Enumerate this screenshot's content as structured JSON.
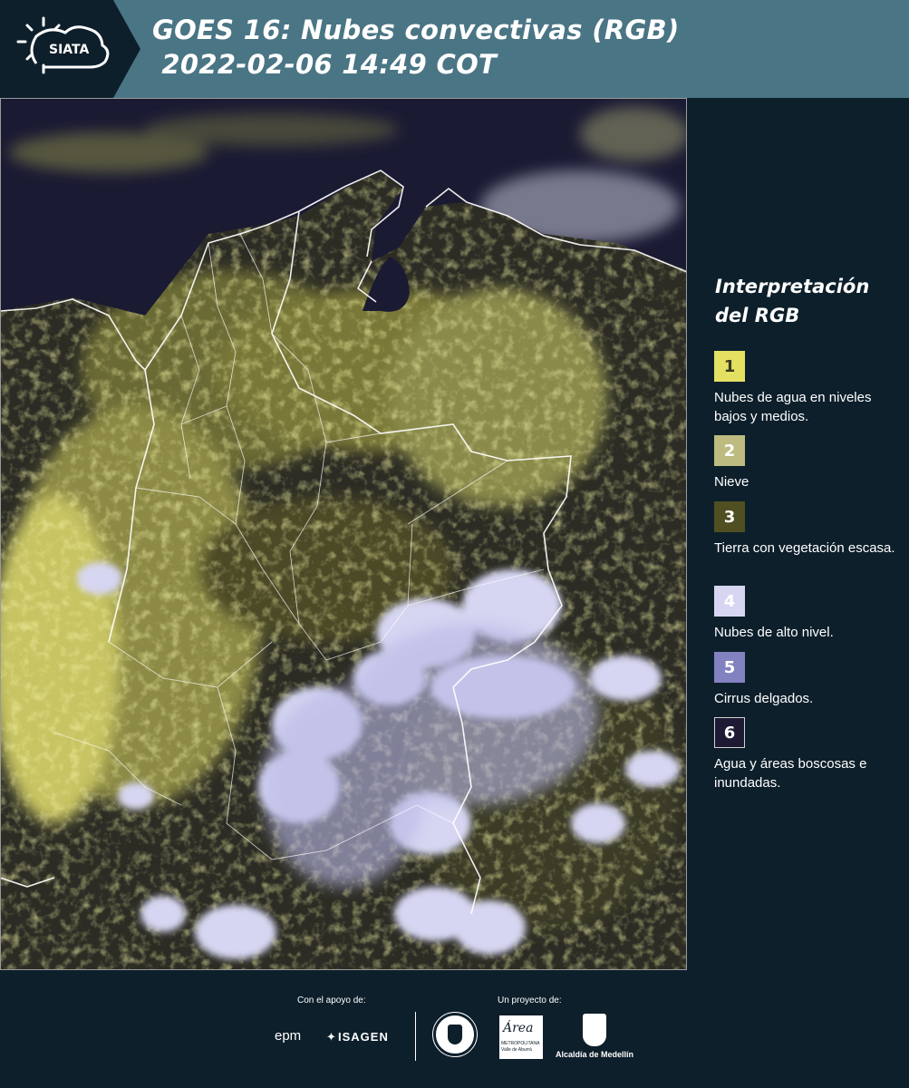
{
  "header": {
    "logo_text": "SIATA",
    "title": "GOES 16: Nubes convectivas (RGB)\n 2022-02-06 14:49 COT"
  },
  "legend": {
    "title": "Interpretación del RGB",
    "items": [
      {
        "number": "1",
        "label": "Nubes de agua en niveles bajos y medios.",
        "color": "#e3e062",
        "text_color": "#3a3a20"
      },
      {
        "number": "2",
        "label": "Nieve",
        "color": "#bdbb80",
        "text_color": "#ffffff"
      },
      {
        "number": "3",
        "label": "Tierra con vegetación escasa.",
        "color": "#4f4f22",
        "text_color": "#ffffff"
      },
      {
        "number": "4",
        "label": "Nubes de alto nivel.",
        "color": "#d6d6f2",
        "text_color": "#ffffff"
      },
      {
        "number": "5",
        "label": "Cirrus delgados.",
        "color": "#8282c0",
        "text_color": "#ffffff"
      },
      {
        "number": "6",
        "label": "Agua y áreas boscosas e inundadas.",
        "color": "#1e1a33",
        "text_color": "#ffffff"
      }
    ]
  },
  "footer": {
    "support_label": "Con el apoyo de:",
    "project_label": "Un proyecto de:",
    "sponsor_1": "epm",
    "sponsor_2": "ISAGEN",
    "partner_2": "Área",
    "partner_2_sub": "METROPOLITANA\nValle de Aburrá",
    "partner_3": "Alcaldía de Medellín"
  },
  "colors": {
    "header_bg": "#4a7585",
    "panel_bg": "#0d1f2b",
    "low_cloud": "#e3e062",
    "high_cloud": "#d6d6f2",
    "ocean": "#1a1a33"
  }
}
